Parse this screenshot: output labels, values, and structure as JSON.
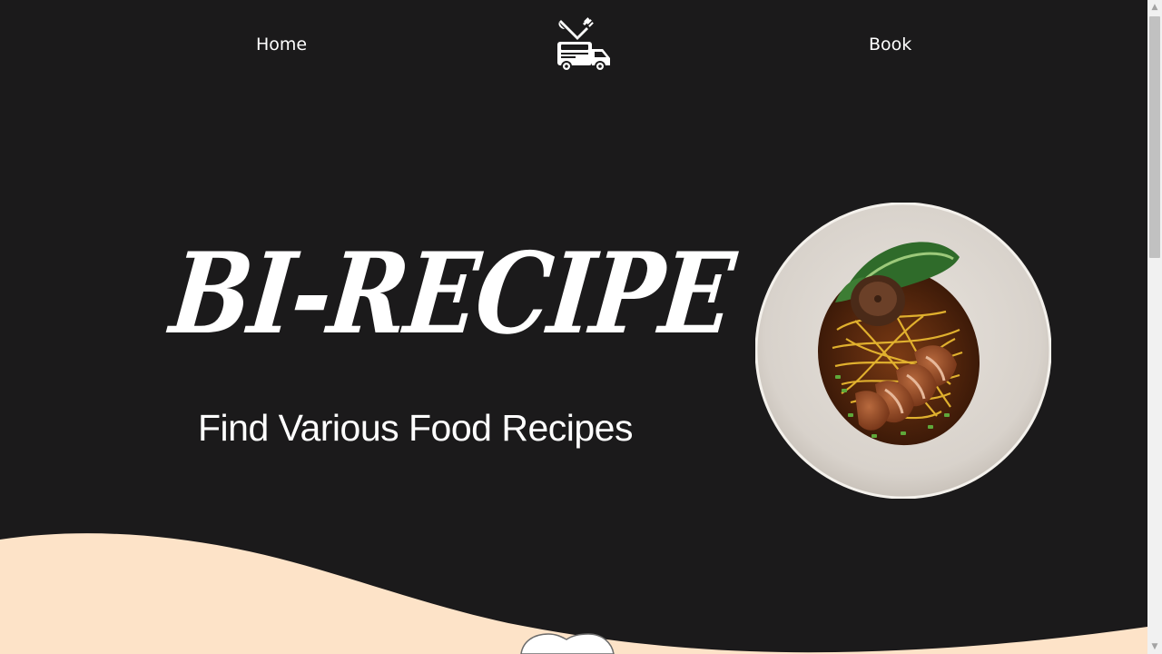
{
  "nav": {
    "home_label": "Home",
    "book_label": "Book",
    "logo_icon": "food-truck-cutlery-icon"
  },
  "hero": {
    "title": "BI-RECIPE",
    "subtitle": "Find Various Food Recipes",
    "image_icon": "noodle-bowl-with-duck-image"
  },
  "colors": {
    "background": "#1b1a1b",
    "text": "#ffffff",
    "wave": "#fde3c8"
  }
}
